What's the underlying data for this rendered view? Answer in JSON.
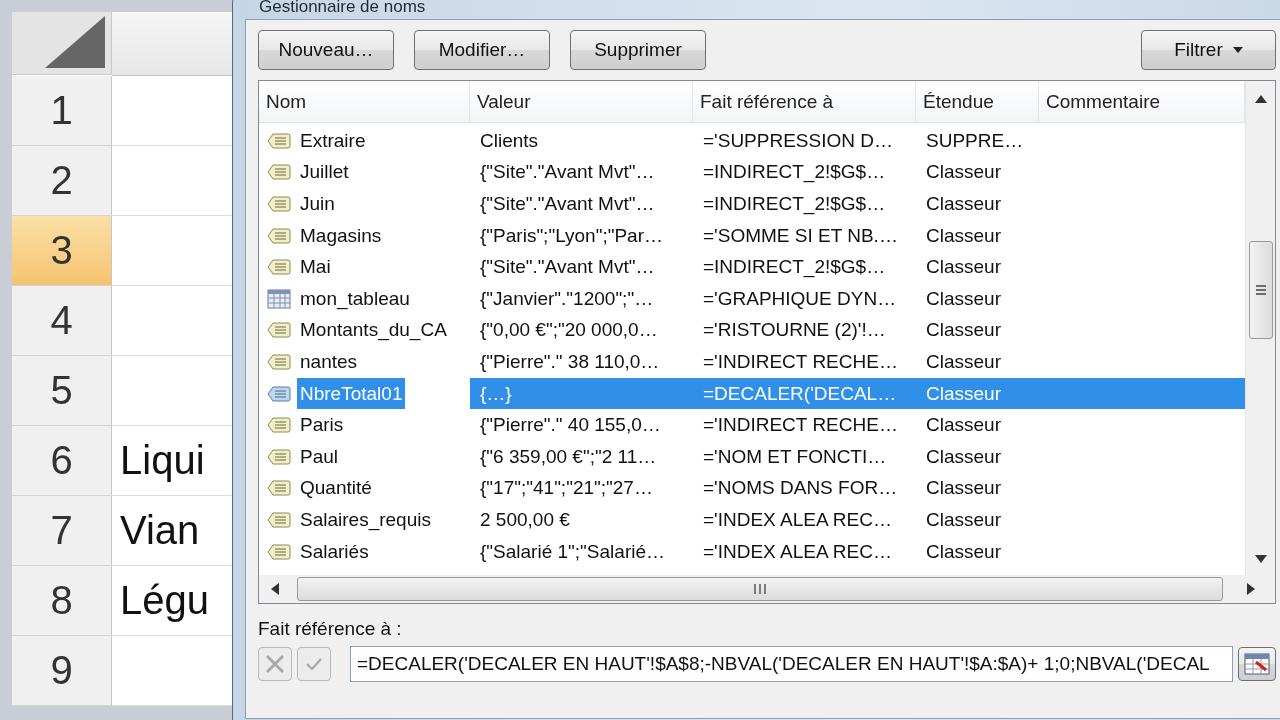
{
  "window": {
    "title": "Gestionnaire de noms"
  },
  "sheet": {
    "rows": [
      {
        "header": "1",
        "selected": false
      },
      {
        "header": "2",
        "selected": false
      },
      {
        "header": "3",
        "selected": true
      },
      {
        "header": "4",
        "selected": false
      },
      {
        "header": "5",
        "selected": false
      },
      {
        "header": "6",
        "selected": false,
        "cell": "Liqui"
      },
      {
        "header": "7",
        "selected": false,
        "cell": "Vian"
      },
      {
        "header": "8",
        "selected": false,
        "cell": "Légu"
      },
      {
        "header": "9",
        "selected": false
      }
    ]
  },
  "toolbar": {
    "buttons": [
      "Nouveau…",
      "Modifier…",
      "Supprimer"
    ],
    "filter": "Filtrer"
  },
  "names_list": {
    "columns": [
      "Nom",
      "Valeur",
      "Fait référence à",
      "Étendue",
      "Commentaire"
    ],
    "rows": [
      {
        "kind": "name",
        "name": "Extraire",
        "value": "Clients",
        "refers_to": "='SUPPRESSION D…",
        "scope": "SUPPRE…",
        "selected": false
      },
      {
        "kind": "name",
        "name": "Juillet",
        "value": "{\"Site\".\"Avant Mvt\"…",
        "refers_to": "=INDIRECT_2!$G$…",
        "scope": "Classeur",
        "selected": false
      },
      {
        "kind": "name",
        "name": "Juin",
        "value": "{\"Site\".\"Avant Mvt\"…",
        "refers_to": "=INDIRECT_2!$G$…",
        "scope": "Classeur",
        "selected": false
      },
      {
        "kind": "name",
        "name": "Magasins",
        "value": "{\"Paris\";\"Lyon\";\"Par…",
        "refers_to": "='SOMME SI ET NB.…",
        "scope": "Classeur",
        "selected": false
      },
      {
        "kind": "name",
        "name": "Mai",
        "value": "{\"Site\".\"Avant Mvt\"…",
        "refers_to": "=INDIRECT_2!$G$…",
        "scope": "Classeur",
        "selected": false
      },
      {
        "kind": "table",
        "name": "mon_tableau",
        "value": "{\"Janvier\".\"1200\";\"…",
        "refers_to": "='GRAPHIQUE DYN…",
        "scope": "Classeur",
        "selected": false
      },
      {
        "kind": "name",
        "name": "Montants_du_CA",
        "value": "{\"0,00 €\";\"20 000,0…",
        "refers_to": "='RISTOURNE (2)'!…",
        "scope": "Classeur",
        "selected": false
      },
      {
        "kind": "name",
        "name": "nantes",
        "value": "{\"Pierre\".\" 38 110,0…",
        "refers_to": "='INDIRECT RECHE…",
        "scope": "Classeur",
        "selected": false
      },
      {
        "kind": "name",
        "name": "NbreTotal01",
        "value": "{…}",
        "refers_to": "=DECALER('DECAL…",
        "scope": "Classeur",
        "selected": true
      },
      {
        "kind": "name",
        "name": "Paris",
        "value": "{\"Pierre\".\" 40 155,0…",
        "refers_to": "='INDIRECT RECHE…",
        "scope": "Classeur",
        "selected": false
      },
      {
        "kind": "name",
        "name": "Paul",
        "value": "{\"6 359,00 €\";\"2 11…",
        "refers_to": "='NOM ET FONCTI…",
        "scope": "Classeur",
        "selected": false
      },
      {
        "kind": "name",
        "name": "Quantité",
        "value": "{\"17\";\"41\";\"21\";\"27…",
        "refers_to": "='NOMS DANS FOR…",
        "scope": "Classeur",
        "selected": false
      },
      {
        "kind": "name",
        "name": "Salaires_requis",
        "value": "2 500,00 €",
        "refers_to": "='INDEX ALEA REC…",
        "scope": "Classeur",
        "selected": false
      },
      {
        "kind": "name",
        "name": "Salariés",
        "value": "{\"Salarié 1\";\"Salarié…",
        "refers_to": "='INDEX ALEA REC…",
        "scope": "Classeur",
        "selected": false
      }
    ]
  },
  "refers_to": {
    "label": "Fait référence à :",
    "value": "=DECALER('DECALER EN HAUT'!$A$8;-NBVAL('DECALER EN HAUT'!$A:$A)+ 1;0;NBVAL('DECAL"
  }
}
